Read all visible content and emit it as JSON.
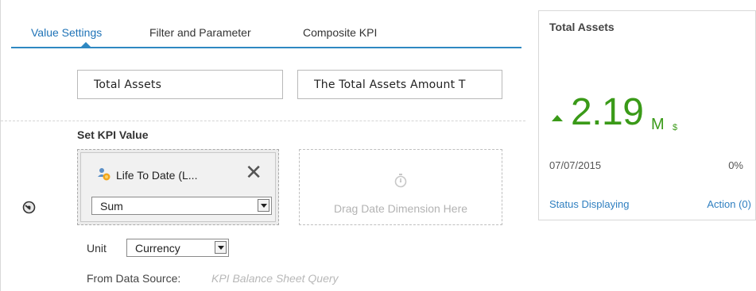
{
  "tabs": [
    {
      "label": "Value Settings",
      "active": true
    },
    {
      "label": "Filter and Parameter",
      "active": false
    },
    {
      "label": "Composite KPI",
      "active": false
    }
  ],
  "fields": {
    "kpi_name": "Total Assets",
    "kpi_description": "The Total Assets Amount T"
  },
  "kpi_value_section": {
    "title": "Set KPI Value",
    "measure": {
      "label": "Life To Date (L...",
      "icon": "measure-icon"
    },
    "aggregation": {
      "selected": "Sum"
    },
    "date_drop_zone": {
      "text": "Drag Date Dimension Here",
      "icon": "stopwatch-icon"
    },
    "unit": {
      "label": "Unit",
      "selected": "Currency"
    },
    "data_source": {
      "label": "From Data Source:",
      "value": "KPI Balance Sheet Query"
    }
  },
  "preview": {
    "title": "Total Assets",
    "value": "2.19",
    "unit": "M",
    "currency": "$",
    "trend": "up",
    "date": "07/07/2015",
    "change": "0%",
    "status_link": "Status Displaying",
    "action_link": "Action (0)"
  },
  "colors": {
    "accent": "#2f88c2",
    "positive": "#3a9a18",
    "link": "#2f7fc0"
  }
}
